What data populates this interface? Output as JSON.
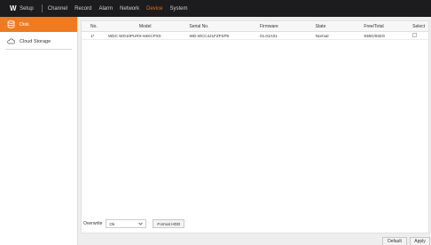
{
  "topbar": {
    "logo": "W",
    "app_title": "Setup",
    "nav": [
      "Channel",
      "Record",
      "Alarm",
      "Network",
      "Device",
      "System"
    ],
    "active": "Device",
    "accent": "#ef6a1a"
  },
  "sidebar": {
    "items": [
      {
        "label": "Disk",
        "icon": "disk-icon",
        "active": true
      },
      {
        "label": "Cloud Storage",
        "icon": "cloud-icon",
        "active": false
      }
    ]
  },
  "table": {
    "headers": [
      "No.",
      "Model",
      "Serial No.",
      "Firmware",
      "State",
      "Free/Total",
      "Select"
    ],
    "rows": [
      {
        "no": "1*",
        "model": "WDC WD10PURX-64KCPX0",
        "serial": "WD-WCC4J1FZFSP8",
        "firmware": "01.01A01",
        "state": "Normal",
        "free_total": "936G/932G",
        "select": false
      }
    ]
  },
  "controls": {
    "overwrite_label": "Overwrite",
    "overwrite_value": "Ok",
    "format_button": "Format HDD"
  },
  "footer": {
    "default": "Default",
    "apply": "Apply"
  }
}
